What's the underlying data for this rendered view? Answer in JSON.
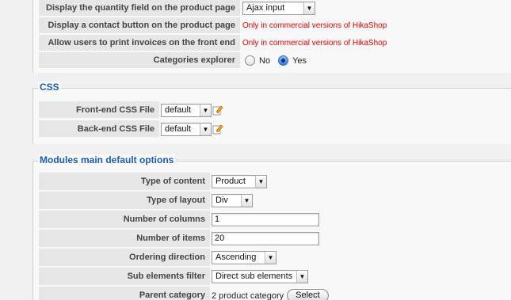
{
  "product_section": {
    "rows": [
      {
        "label": "Display the quantity field on the product page",
        "value": "Ajax input"
      },
      {
        "label": "Display a contact button on the product page",
        "value": "Only in commercial versions of HikaShop"
      },
      {
        "label": "Allow users to print invoices on the front end",
        "value": "Only in commercial versions of HikaShop"
      },
      {
        "label": "Categories explorer",
        "options": [
          "No",
          "Yes"
        ],
        "selected": "Yes"
      }
    ]
  },
  "css_section": {
    "legend": "CSS",
    "rows": [
      {
        "label": "Front-end CSS File",
        "value": "default"
      },
      {
        "label": "Back-end CSS File",
        "value": "default"
      }
    ]
  },
  "modules_section": {
    "legend": "Modules main default options",
    "type_of_content": {
      "label": "Type of content",
      "value": "Product"
    },
    "type_of_layout": {
      "label": "Type of layout",
      "value": "Div"
    },
    "number_of_columns": {
      "label": "Number of columns",
      "value": "1"
    },
    "number_of_items": {
      "label": "Number of items",
      "value": "20"
    },
    "ordering_direction": {
      "label": "Ordering direction",
      "value": "Ascending"
    },
    "sub_elements_filter": {
      "label": "Sub elements filter",
      "value": "Direct sub elements"
    },
    "parent_category": {
      "label": "Parent category",
      "value": "2 product category",
      "button": "Select"
    }
  },
  "colors": {
    "legend": "#1c5cab",
    "warning": "#e00000",
    "label_bg": "#e6e6e6"
  },
  "icons": [
    "edit-icon",
    "chevron-down-icon",
    "radio-icon"
  ]
}
